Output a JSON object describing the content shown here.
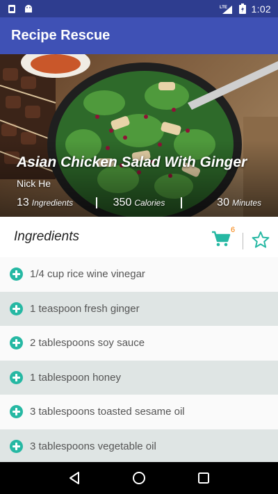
{
  "status_bar": {
    "time": "1:02",
    "network_label": "LTE",
    "icons": [
      "notification-icon",
      "android-icon",
      "lte-signal-icon",
      "battery-icon"
    ]
  },
  "app_bar": {
    "title": "Recipe Rescue"
  },
  "recipe": {
    "title": "Asian Chicken Salad With Ginger",
    "author": "Nick He",
    "stats": [
      {
        "value": "13",
        "label": "Ingredients"
      },
      {
        "value": "350",
        "label": "Calories"
      },
      {
        "value": "30",
        "label": "Minutes"
      }
    ]
  },
  "ingredients": {
    "heading": "Ingredients",
    "cart_count": "6",
    "items": [
      "1/4 cup rice wine vinegar",
      "1 teaspoon fresh ginger",
      "2 tablespoons soy sauce",
      "1 tablespoon honey",
      "3 tablespoons toasted sesame oil",
      "3 tablespoons vegetable oil"
    ]
  },
  "colors": {
    "status_bar": "#2e3d8f",
    "app_bar": "#3f51b5",
    "accent": "#26b8a3",
    "badge": "#f57c00",
    "row_alt": "#dfe5e4"
  }
}
